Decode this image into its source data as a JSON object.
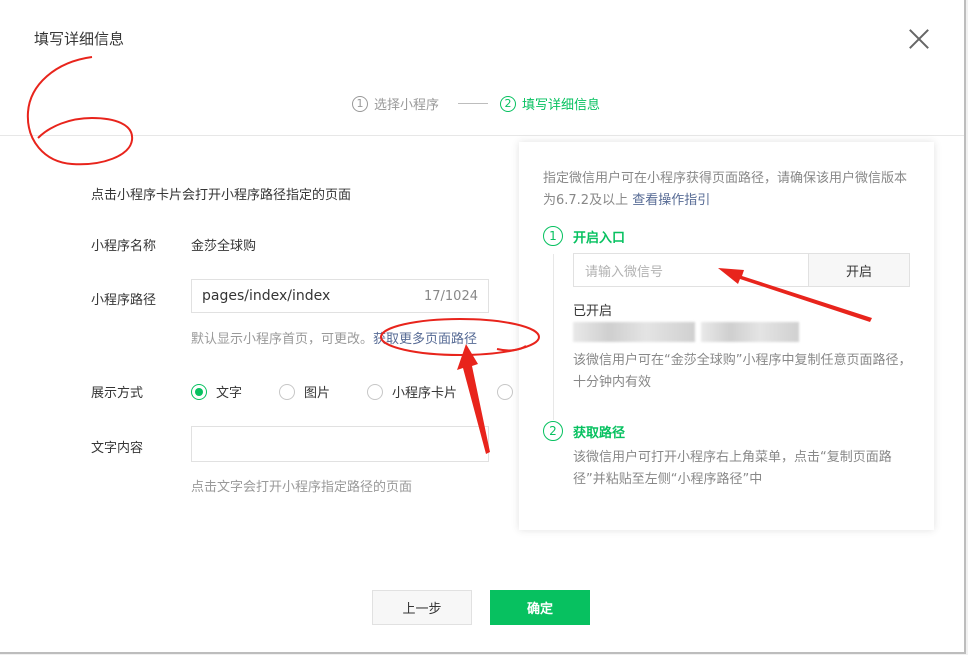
{
  "dialog": {
    "title": "填写详细信息"
  },
  "steps": [
    {
      "num": "1",
      "label": "选择小程序"
    },
    {
      "num": "2",
      "label": "填写详细信息"
    }
  ],
  "form": {
    "description": "点击小程序卡片会打开小程序路径指定的页面",
    "name_label": "小程序名称",
    "name_value": "金莎全球购",
    "path_label": "小程序路径",
    "path_value": "pages/index/index",
    "path_count": "17/1024",
    "path_hint": "默认显示小程序首页，可更改。",
    "path_link": "获取更多页面路径",
    "display_label": "展示方式",
    "display_options": [
      "文字",
      "图片",
      "小程序卡片"
    ],
    "display_selected": "文字",
    "text_label": "文字内容",
    "text_hint": "点击文字会打开小程序指定路径的页面"
  },
  "panel": {
    "description": "指定微信用户可在小程序获得页面路径，请确保该用户微信版本为6.7.2及以上",
    "guide_link": "查看操作指引",
    "step1_num": "1",
    "step1_title": "开启入口",
    "wechat_placeholder": "请输入微信号",
    "enable_button": "开启",
    "opened_label": "已开启",
    "step1_note": "该微信用户可在“金莎全球购”小程序中复制任意页面路径，十分钟内有效",
    "step2_num": "2",
    "step2_title": "获取路径",
    "step2_note": "该微信用户可打开小程序右上角菜单，点击“复制页面路径”并粘贴至左侧“小程序路径”中"
  },
  "footer": {
    "prev_label": "上一步",
    "confirm_label": "确定"
  },
  "colors": {
    "accent": "#07c160",
    "link": "#576b95",
    "annotation": "#e8241c"
  }
}
